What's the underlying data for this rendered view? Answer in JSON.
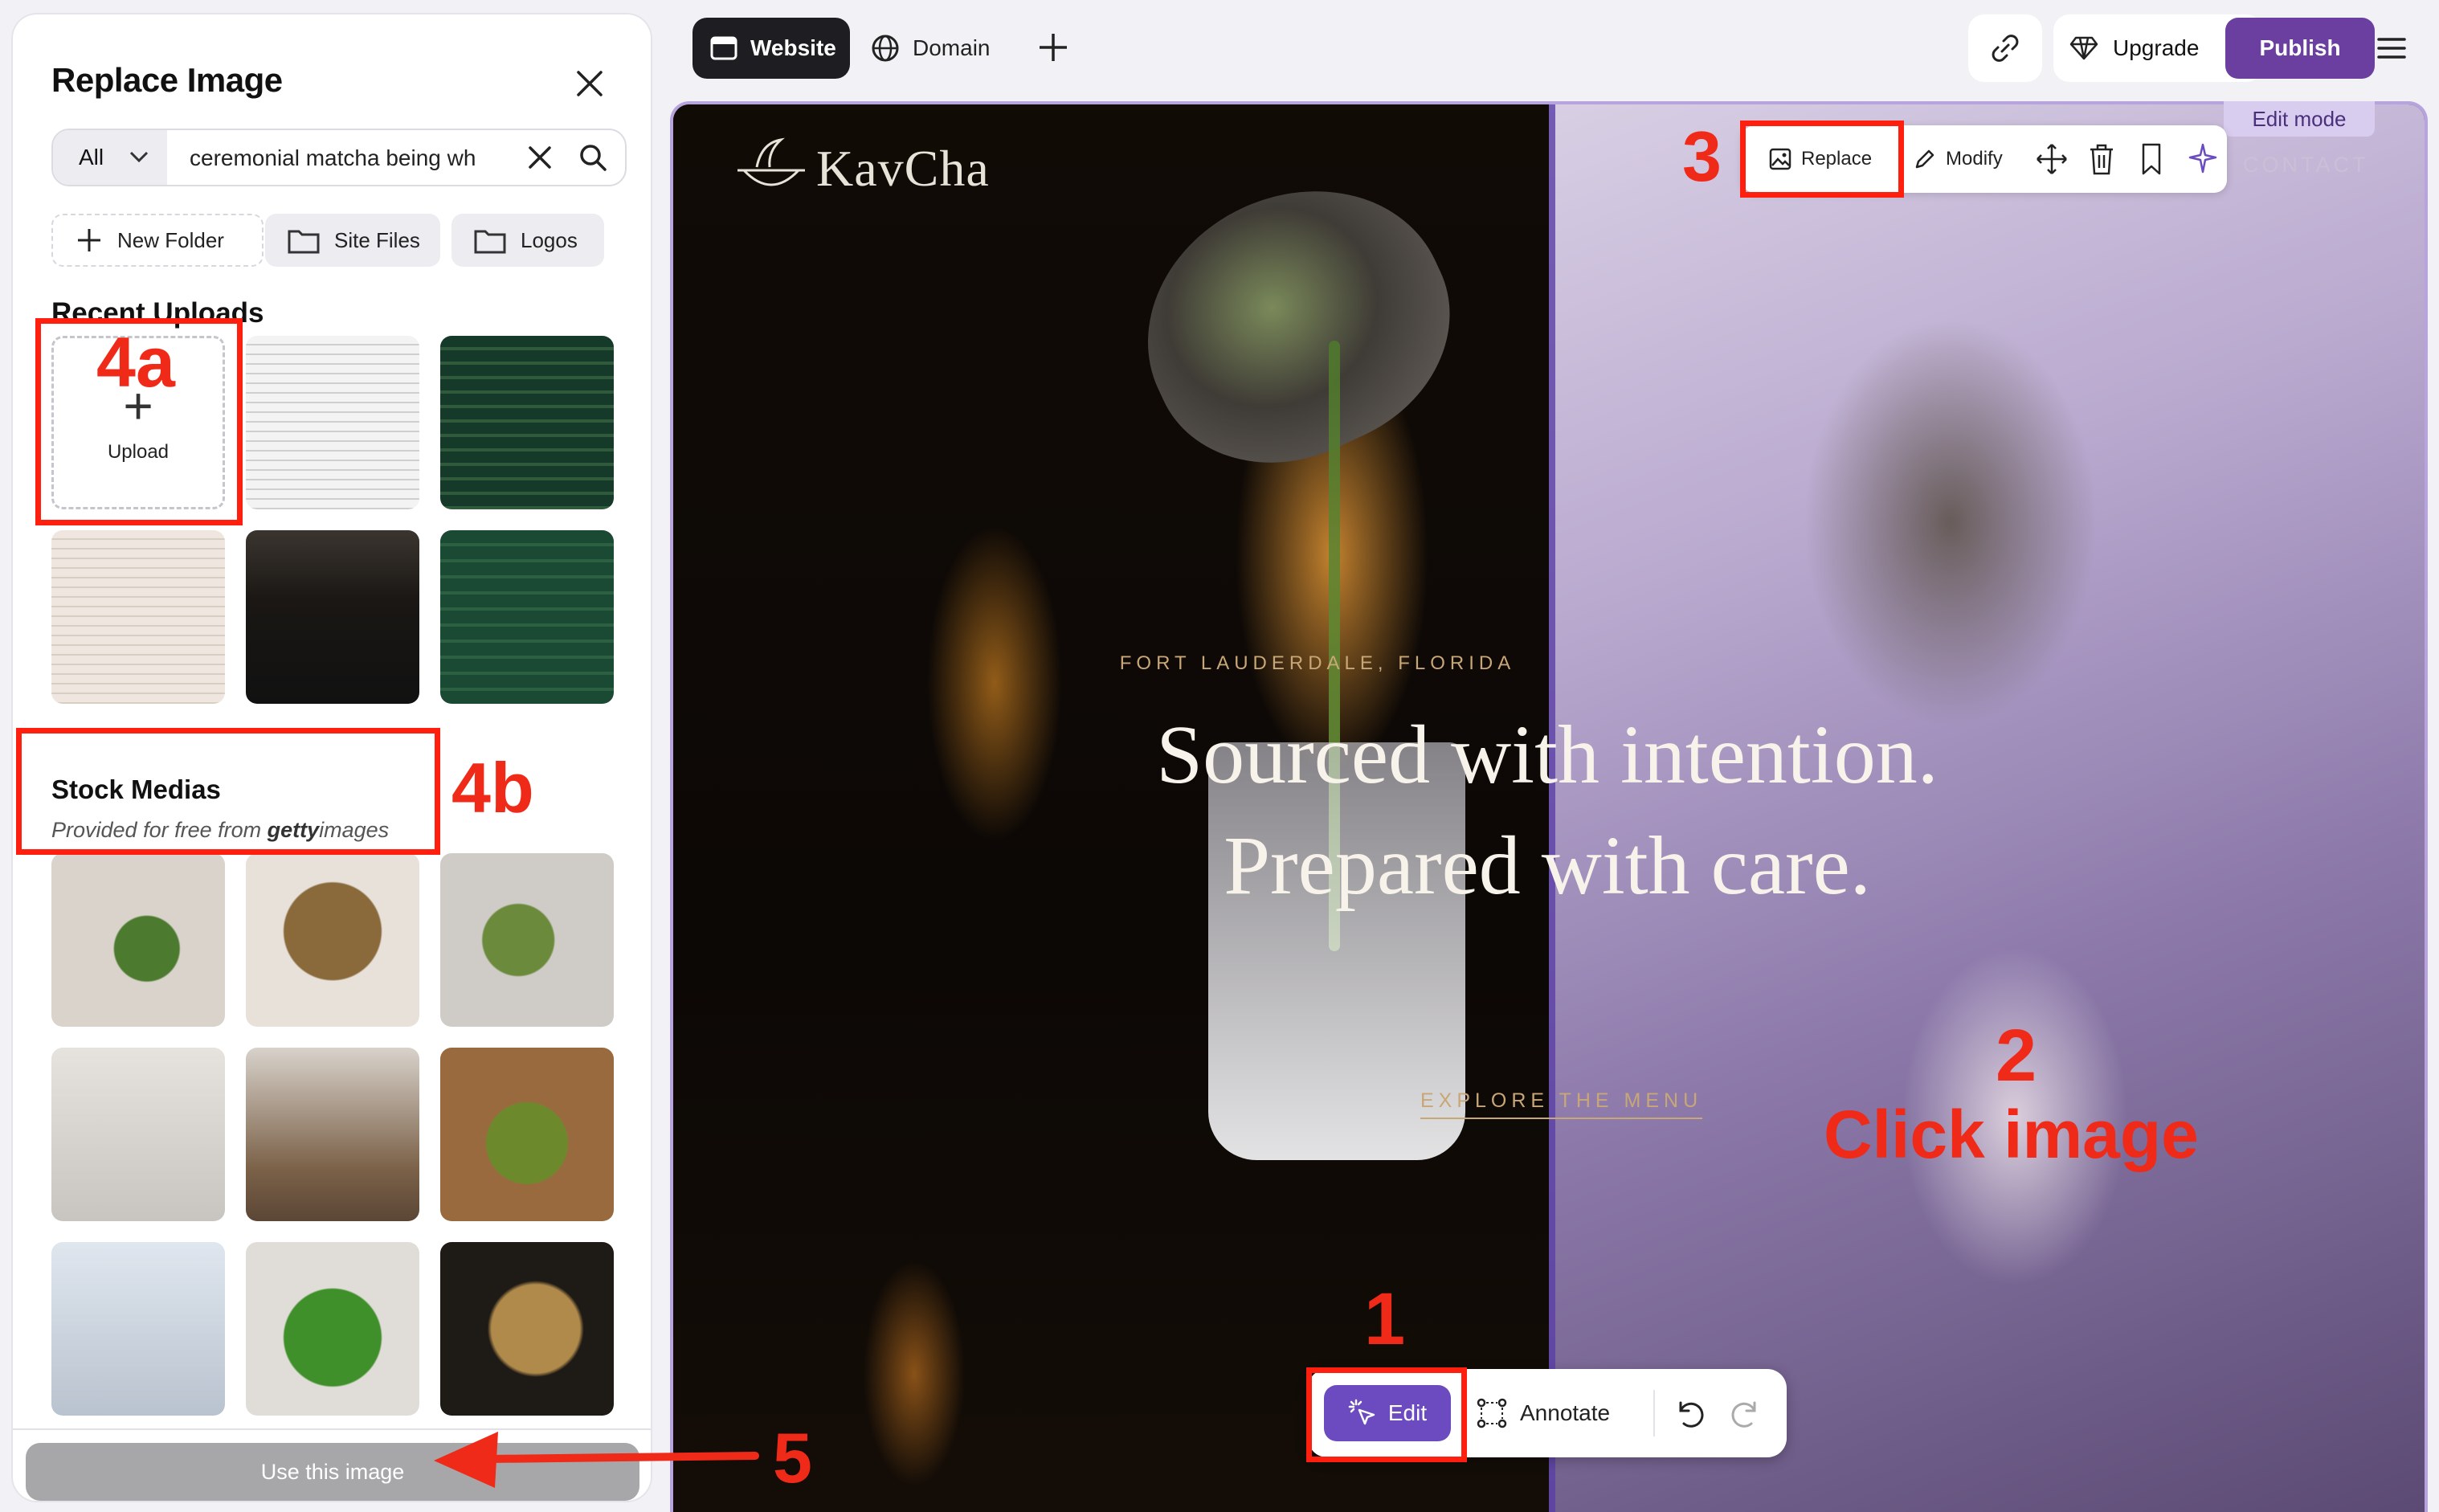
{
  "panel": {
    "title": "Replace Image",
    "filter_label": "All",
    "search_value": "ceremonial matcha being wh",
    "chips": {
      "new_folder": "New Folder",
      "site_files": "Site Files",
      "logos": "Logos"
    },
    "recent_title": "Recent Uploads",
    "upload_label": "Upload",
    "stock_title": "Stock Medias",
    "stock_sub_prefix": "Provided for free from ",
    "stock_sub_brand_a": "getty",
    "stock_sub_brand_b": "images",
    "use_button": "Use this image"
  },
  "topbar": {
    "tab_website": "Website",
    "tab_domain": "Domain",
    "upgrade": "Upgrade",
    "publish": "Publish"
  },
  "canvas": {
    "edit_mode": "Edit mode",
    "logo": "KavCha",
    "contact": "CONTACT",
    "eyebrow": "FORT LAUDERDALE, FLORIDA",
    "hero_line1": "Sourced with intention.",
    "hero_line2": "Prepared with care.",
    "explore": "EXPLORE THE MENU",
    "toolbar": {
      "replace": "Replace",
      "modify": "Modify"
    },
    "bottom": {
      "edit": "Edit",
      "annotate": "Annotate"
    }
  },
  "annotations": {
    "step1": "1",
    "step2": "2",
    "step2_label": "Click image",
    "step3": "3",
    "step4a": "4a",
    "step4b": "4b",
    "step5": "5"
  },
  "colors": {
    "accent_purple": "#6b3fa0",
    "annotation_red": "#f02a18",
    "gold_text": "#c8a777"
  }
}
